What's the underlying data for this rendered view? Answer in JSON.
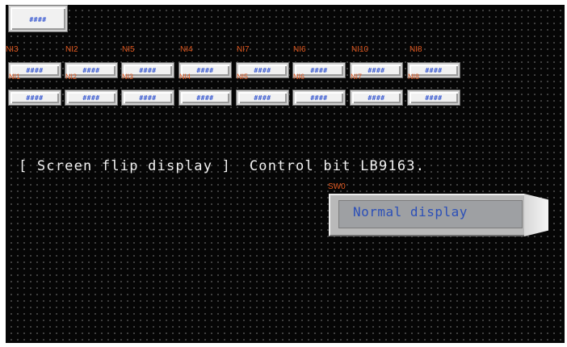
{
  "top_field": {
    "value": "####"
  },
  "ni_labels": [
    "NI3",
    "NI2",
    "NI5",
    "NI4",
    "NI7",
    "NI6",
    "NI10",
    "NI8"
  ],
  "row1_overlap_labels": [
    "NI1",
    "NI2",
    "NI3",
    "NI4",
    "NI5",
    "NI6",
    "NI7",
    "NI8"
  ],
  "row1_values": [
    "####",
    "####",
    "####",
    "####",
    "####",
    "####",
    "####",
    "####"
  ],
  "row2_values": [
    "####",
    "####",
    "####",
    "####",
    "####",
    "####",
    "####",
    "####"
  ],
  "caption": "[ Screen flip display ]  Control bit LB9163.",
  "switch": {
    "label": "SW0",
    "text": "Normal display"
  },
  "colors": {
    "label": "#e2581f",
    "value": "#3b5bd1",
    "caption": "#f2f2f2",
    "background": "#060606"
  }
}
